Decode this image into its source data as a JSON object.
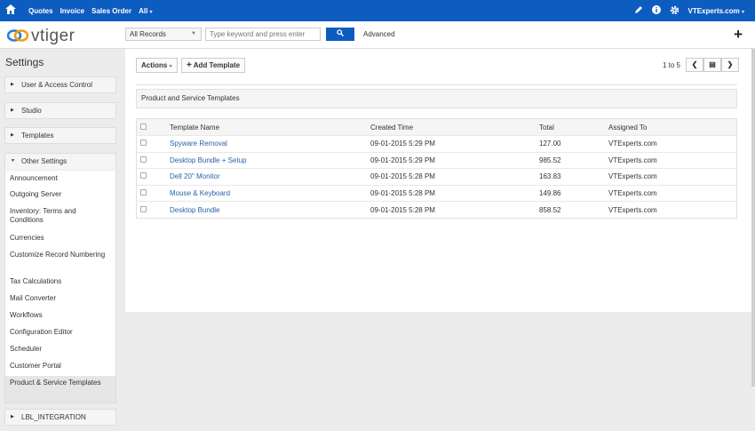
{
  "topbar": {
    "nav": [
      "Quotes",
      "Invoice",
      "Sales Order",
      "All"
    ],
    "user": "VTExperts.com"
  },
  "header": {
    "logo_text": "vtiger",
    "search_select": "All Records",
    "search_placeholder": "Type keyword and press enter",
    "advanced": "Advanced"
  },
  "sidebar": {
    "title": "Settings",
    "sections": {
      "user_access": "User & Access Control",
      "studio": "Studio",
      "templates": "Templates",
      "other": "Other Settings",
      "integration": "LBL_INTEGRATION"
    },
    "items": [
      "Announcement",
      "Outgoing Server",
      "Inventory: Terms and Conditions",
      "Currencies",
      "Customize Record Numbering",
      "Tax Calculations",
      "Mail Converter",
      "Workflows",
      "Configuration Editor",
      "Scheduler",
      "Customer Portal",
      "Product & Service Templates"
    ]
  },
  "main": {
    "actions": "Actions",
    "add_template": "Add Template",
    "pager": "1 to 5",
    "panel_title": "Product and Service Templates",
    "columns": [
      "Template Name",
      "Created Time",
      "Total",
      "Assigned To"
    ],
    "rows": [
      {
        "name": "Spyware Removal",
        "created": "09-01-2015 5:29 PM",
        "total": "127.00",
        "assigned": "VTExperts.com"
      },
      {
        "name": "Desktop Bundle + Setup",
        "created": "09-01-2015 5:29 PM",
        "total": "985.52",
        "assigned": "VTExperts.com"
      },
      {
        "name": "Dell 20\" Monitor",
        "created": "09-01-2015 5:28 PM",
        "total": "163.83",
        "assigned": "VTExperts.com"
      },
      {
        "name": "Mouse & Keyboard",
        "created": "09-01-2015 5:28 PM",
        "total": "149.86",
        "assigned": "VTExperts.com"
      },
      {
        "name": "Desktop Bundle",
        "created": "09-01-2015 5:28 PM",
        "total": "858.52",
        "assigned": "VTExperts.com"
      }
    ]
  },
  "colors": {
    "primary": "#0d5cc0",
    "link": "#2a63a8",
    "background": "#ececec"
  },
  "icons": [
    "home-icon",
    "pencil-icon",
    "info-icon",
    "gear-icon",
    "plus-icon",
    "search-icon",
    "prev-icon",
    "next-icon",
    "export-icon"
  ]
}
